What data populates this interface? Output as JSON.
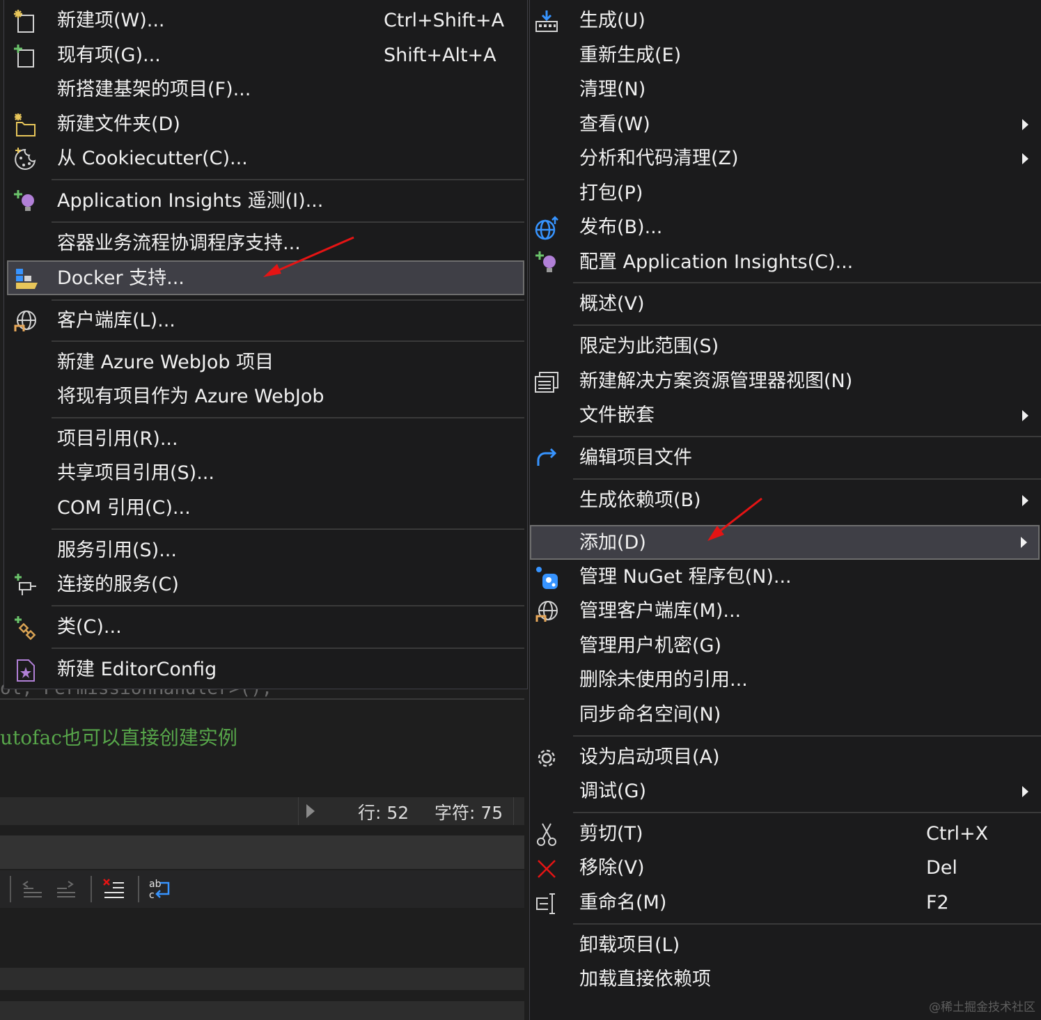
{
  "editor": {
    "faint_code": "ol, PermissionHandler>();",
    "comment": "utofac也可以直接创建实例",
    "status": {
      "line": "行: 52",
      "char": "字符: 75"
    }
  },
  "add_submenu": {
    "items": [
      {
        "label": "新建项(W)...",
        "shortcut": "Ctrl+Shift+A",
        "icon": "new-item-icon"
      },
      {
        "label": "现有项(G)...",
        "shortcut": "Shift+Alt+A",
        "icon": "existing-item-icon"
      },
      {
        "label": "新搭建基架的项目(F)..."
      },
      {
        "label": "新建文件夹(D)",
        "icon": "new-folder-icon"
      },
      {
        "label": "从 Cookiecutter(C)...",
        "icon": "cookiecutter-icon"
      },
      {
        "label": "Application Insights 遥测(I)...",
        "icon": "app-insights-icon"
      },
      {
        "label": "容器业务流程协调程序支持..."
      },
      {
        "label": "Docker 支持...",
        "icon": "docker-icon",
        "highlighted": true
      },
      {
        "label": "客户端库(L)...",
        "icon": "client-library-icon"
      },
      {
        "label": "新建 Azure WebJob 项目"
      },
      {
        "label": "将现有项目作为 Azure WebJob"
      },
      {
        "label": "项目引用(R)..."
      },
      {
        "label": "共享项目引用(S)..."
      },
      {
        "label": "COM 引用(C)..."
      },
      {
        "label": "服务引用(S)..."
      },
      {
        "label": "连接的服务(C)",
        "icon": "connected-service-icon"
      },
      {
        "label": "类(C)...",
        "icon": "class-icon"
      },
      {
        "label": "新建 EditorConfig",
        "icon": "editorconfig-icon"
      }
    ]
  },
  "context_menu": {
    "items": [
      {
        "label": "生成(U)",
        "icon": "build-icon"
      },
      {
        "label": "重新生成(E)"
      },
      {
        "label": "清理(N)"
      },
      {
        "label": "查看(W)",
        "submenu": true
      },
      {
        "label": "分析和代码清理(Z)",
        "submenu": true
      },
      {
        "label": "打包(P)"
      },
      {
        "label": "发布(B)...",
        "icon": "publish-globe-icon"
      },
      {
        "label": "配置 Application Insights(C)...",
        "icon": "app-insights-icon"
      },
      {
        "label": "概述(V)"
      },
      {
        "label": "限定为此范围(S)"
      },
      {
        "label": "新建解决方案资源管理器视图(N)",
        "icon": "new-view-icon"
      },
      {
        "label": "文件嵌套",
        "submenu": true
      },
      {
        "label": "编辑项目文件",
        "icon": "edit-project-icon"
      },
      {
        "label": "生成依赖项(B)",
        "submenu": true
      },
      {
        "label": "添加(D)",
        "submenu": true,
        "highlighted": true
      },
      {
        "label": "管理 NuGet 程序包(N)...",
        "icon": "nuget-icon"
      },
      {
        "label": "管理客户端库(M)...",
        "icon": "client-library-icon"
      },
      {
        "label": "管理用户机密(G)"
      },
      {
        "label": "删除未使用的引用..."
      },
      {
        "label": "同步命名空间(N)"
      },
      {
        "label": "设为启动项目(A)",
        "icon": "gear-icon"
      },
      {
        "label": "调试(G)",
        "submenu": true
      },
      {
        "label": "剪切(T)",
        "shortcut": "Ctrl+X",
        "icon": "scissors-icon"
      },
      {
        "label": "移除(V)",
        "shortcut": "Del",
        "icon": "remove-x-icon"
      },
      {
        "label": "重命名(M)",
        "shortcut": "F2",
        "icon": "rename-icon"
      },
      {
        "label": "卸载项目(L)"
      },
      {
        "label": "加载直接依赖项"
      }
    ]
  },
  "watermark": "@稀土掘金技术社区",
  "colors": {
    "menu_bg": "#1b1b1c",
    "highlight_bg": "#3f3f46",
    "annotation_red": "#e51414",
    "comment_green": "#57a64a"
  }
}
